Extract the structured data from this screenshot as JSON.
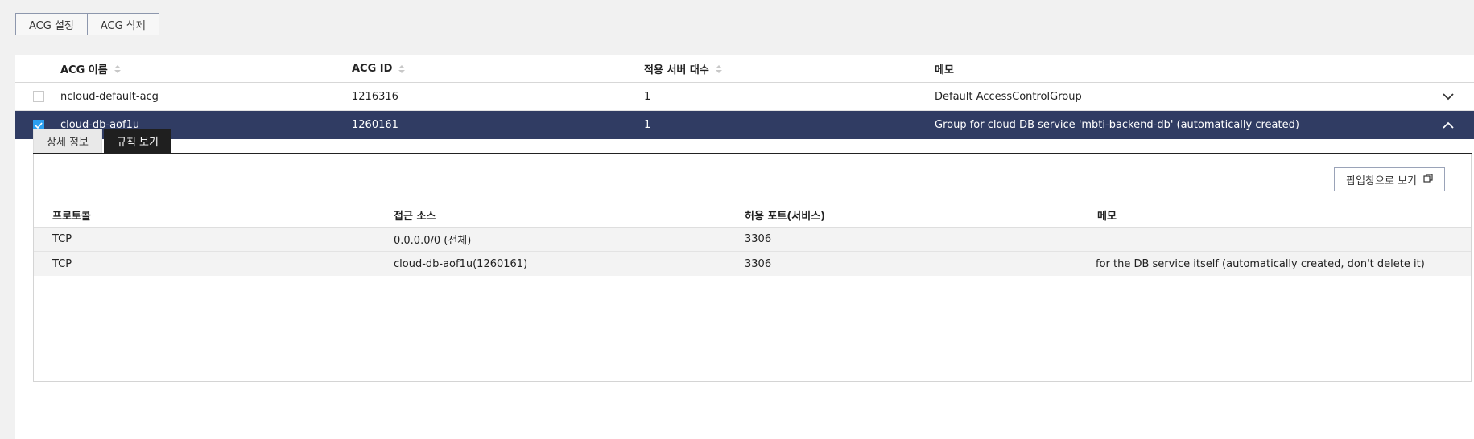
{
  "toolbar": {
    "set_label": "ACG 설정",
    "delete_label": "ACG 삭제"
  },
  "acg_table": {
    "headers": [
      "ACG 이름",
      "ACG ID",
      "적용 서버 대수",
      "메모"
    ],
    "rows": [
      {
        "name": "ncloud-default-acg",
        "id": "1216316",
        "count": "1",
        "memo": "Default AccessControlGroup",
        "checked": false,
        "expanded": false
      },
      {
        "name": "cloud-db-aof1u",
        "id": "1260161",
        "count": "1",
        "memo": "Group for cloud DB service 'mbti-backend-db' (automatically created)",
        "checked": true,
        "expanded": true
      }
    ]
  },
  "detail": {
    "tabs": [
      {
        "label": "상세 정보",
        "active": false
      },
      {
        "label": "규칙 보기",
        "active": true
      }
    ],
    "popup_button_label": "팝업창으로 보기",
    "rules": {
      "headers": [
        "프로토콜",
        "접근 소스",
        "허용 포트(서비스)",
        "메모"
      ],
      "rows": [
        {
          "protocol": "TCP",
          "source": "0.0.0.0/0 (전체)",
          "port": "3306",
          "memo": ""
        },
        {
          "protocol": "TCP",
          "source": "cloud-db-aof1u(1260161)",
          "port": "3306",
          "memo": "for the DB service itself (automatically created, don't delete it)"
        }
      ]
    }
  },
  "colors": {
    "selected_row": "#303c63",
    "checkbox": "#2b9ff0",
    "active_tab": "#1f1f1f"
  },
  "icons": [
    "sort-icon",
    "checkbox-icon",
    "chevron-down-icon",
    "chevron-up-icon",
    "popup-window-icon"
  ]
}
